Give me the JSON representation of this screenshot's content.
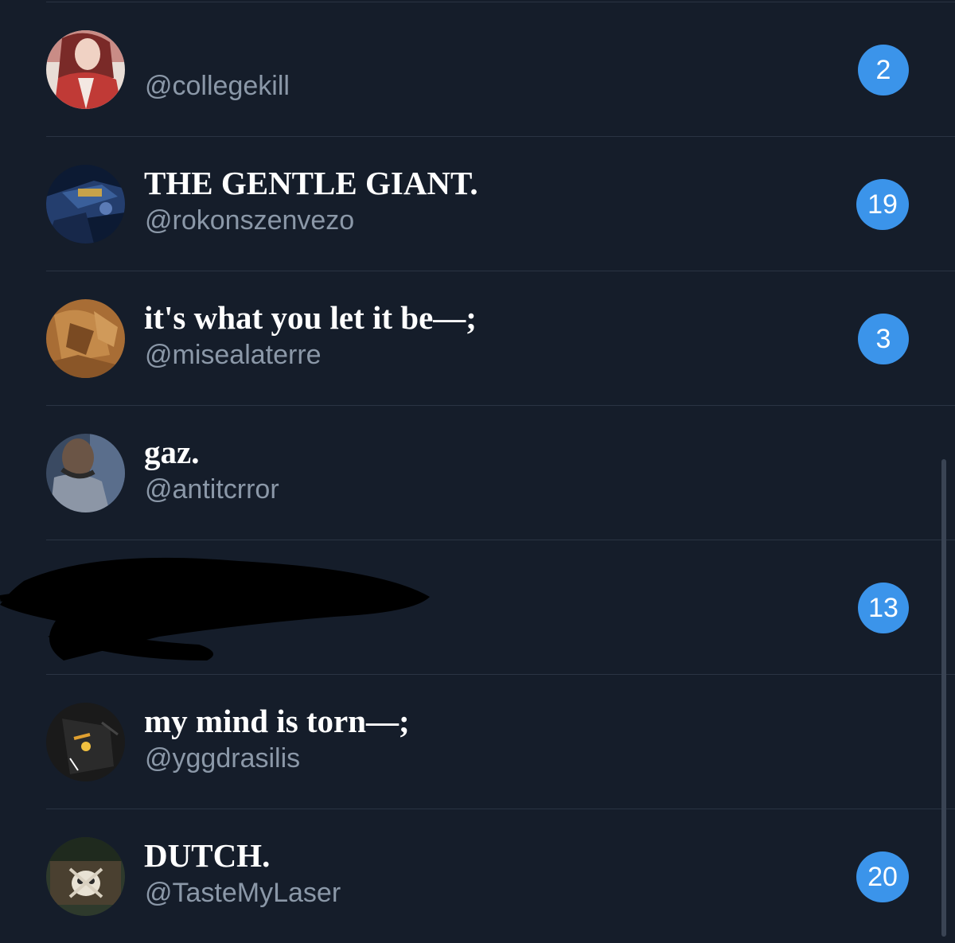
{
  "rows": [
    {
      "name": "",
      "handle": "@collegekill",
      "badge": "2",
      "avatar_icon": "avatar-red-hoodie"
    },
    {
      "name": "THE GENTLE GIANT.",
      "handle": "@rokonszenvezo",
      "badge": "19",
      "avatar_icon": "avatar-blue-armor"
    },
    {
      "name": "it's what you let it be—;",
      "handle": "@misealaterre",
      "badge": "3",
      "avatar_icon": "avatar-sepia-illustration"
    },
    {
      "name": "gaz.",
      "handle": "@antitcrror",
      "badge": "",
      "avatar_icon": "avatar-man-profile"
    },
    {
      "name": "",
      "handle": "",
      "badge": "13",
      "avatar_icon": "redacted"
    },
    {
      "name": "my mind is torn—;",
      "handle": "@yggdrasilis",
      "badge": "",
      "avatar_icon": "avatar-dark-helmet"
    },
    {
      "name": "DUTCH.",
      "handle": "@TasteMyLaser",
      "badge": "20",
      "avatar_icon": "avatar-skull-patch"
    }
  ],
  "colors": {
    "background": "#151d2a",
    "divider": "#2a3443",
    "name_text": "#ffffff",
    "handle_text": "#8b98a8",
    "badge": "#3b94ea"
  }
}
